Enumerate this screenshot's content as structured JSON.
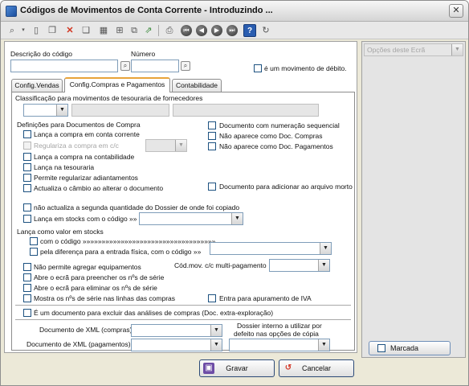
{
  "window": {
    "title": "Códigos de Movimentos de Conta Corrente - Introduzindo ..."
  },
  "fields": {
    "descricao_label": "Descrição do código",
    "descricao_value": "",
    "numero_label": "Número",
    "numero_value": "",
    "debito_label": "é um movimento de débito."
  },
  "tabs": [
    {
      "label": "Config.Vendas"
    },
    {
      "label": "Config.Compras e Pagamentos"
    },
    {
      "label": "Contabilidade"
    }
  ],
  "panel": {
    "classificacao_label": "Classificação para movimentos de tesouraria de fornecedores",
    "definicoes_label": "Definições para Documentos de Compra",
    "left_checks": [
      {
        "label": "Lança a compra em conta corrente",
        "disabled": false
      },
      {
        "label": "Regulariza a compra em c/c",
        "disabled": true
      },
      {
        "label": "Lança a compra na contabilidade",
        "disabled": false
      },
      {
        "label": "Lança na tesouraria",
        "disabled": false
      },
      {
        "label": "Permite regularizar adiantamentos",
        "disabled": false
      },
      {
        "label": "Actualiza o câmbio ao alterar o documento",
        "disabled": false
      }
    ],
    "right_checks": [
      {
        "label": "Documento com numeração sequencial"
      },
      {
        "label": "Não aparece como Doc. Compras"
      },
      {
        "label": "Não aparece como Doc. Pagamentos"
      }
    ],
    "arquivo_morto_label": "Documento para adicionar ao arquivo morto",
    "segunda_quantidade_label": "não actualiza a segunda quantidade do Dossier de onde foi copiado",
    "stocks_label": "Lança em stocks com o código »»",
    "valor_stocks_label": "Lança como valor em stocks",
    "com_codigo_label": "com o código »»»»»»»»»»»»»»»»»»»»»»»»»»»»»»»»»»»",
    "diferenca_label": "pela diferença para a entrada física, com o código »»",
    "agregar_label": "Não permite agregar equipamentos",
    "multi_pagamento_label": "Cód.mov. c/c multi-pagamento",
    "serie_checks": [
      {
        "label": "Abre o ecrã para preencher os nºs de série"
      },
      {
        "label": "Abre o ecrã para eliminar os nºs de série"
      },
      {
        "label": "Mostra os nºs de série nas linhas das compras"
      }
    ],
    "iva_label": "Entra para apuramento de IVA",
    "excluir_label": "É um documento para excluir das análises de compras (Doc. extra-exploração)",
    "xml_compras_label": "Documento de XML (compras)",
    "xml_pagamentos_label": "Documento de XML (pagamentos)",
    "dossier_label_1": "Dossier interno a utilizar por",
    "dossier_label_2": "defeito nas opções de cópia"
  },
  "buttons": {
    "save": "Gravar",
    "cancel": "Cancelar"
  },
  "sidebar": {
    "options_placeholder": "Opções deste Ecrã",
    "marcada_label": "Marcada"
  },
  "colors": {
    "tab_accent": "#e8a33a",
    "help_button": "#2a5db0",
    "save_icon": "#6e4da6",
    "cancel_icon": "#d43a2a"
  },
  "toolbar_icons": [
    "search-icon",
    "new-document-icon",
    "copy-icon",
    "delete-icon",
    "duplicate-icon",
    "table-icon",
    "tree-icon",
    "network-icon",
    "export-icon",
    "print-preview-icon",
    "first-record-icon",
    "previous-record-icon",
    "next-record-icon",
    "last-record-icon",
    "help-icon",
    "refresh-icon"
  ]
}
